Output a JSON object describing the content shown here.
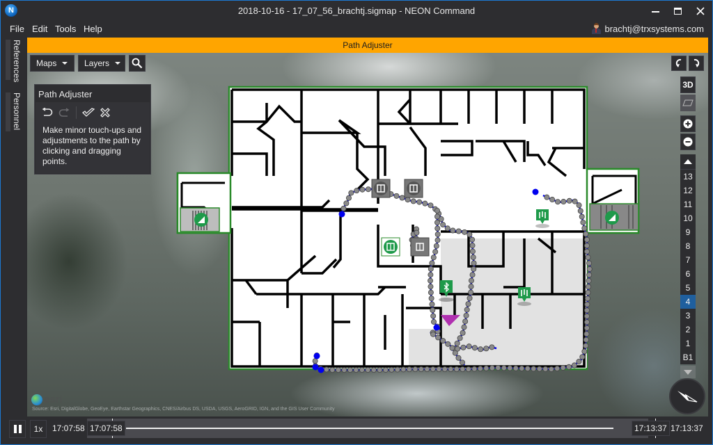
{
  "window": {
    "title": "2018-10-16 - 17_07_56_brachtj.sigmap - NEON Command",
    "app_logo": "N",
    "controls": [
      "minimize",
      "maximize",
      "close"
    ]
  },
  "menu": {
    "items": [
      "File",
      "Edit",
      "Tools",
      "Help"
    ],
    "user": "brachtj@trxsystems.com"
  },
  "sidebar": {
    "tabs": [
      {
        "label": "References"
      },
      {
        "label": "Personnel"
      }
    ]
  },
  "mode_banner": "Path Adjuster",
  "map_toolbar": {
    "maps_label": "Maps",
    "layers_label": "Layers",
    "search_icon": "search-icon"
  },
  "path_adjuster": {
    "title": "Path Adjuster",
    "tools": [
      "undo",
      "redo",
      "accept",
      "cancel"
    ],
    "description": "Make minor touch-ups and adjustments to the path by clicking and dragging points."
  },
  "view_controls": {
    "rotate_left": "rotate-left",
    "rotate_right": "rotate-right",
    "mode_3d": "3D",
    "mode_2d": "2D",
    "zoom_in": "+",
    "zoom_out": "-"
  },
  "floors": {
    "items": [
      "13",
      "12",
      "11",
      "10",
      "9",
      "8",
      "7",
      "6",
      "5",
      "4",
      "3",
      "2",
      "1",
      "B1"
    ],
    "selected": "4"
  },
  "map_markers": {
    "stairs": 2,
    "elevators": 4,
    "restrooms": 2,
    "bluetooth_beacons": 1
  },
  "attribution": {
    "logo_text": "esri",
    "source": "Source: Esri, DigitalGlobe, GeoEye, Earthstar Geographics, CNES/Airbus DS, USDA, USGS, AeroGRID, IGN, and the GIS User Community"
  },
  "timeline": {
    "state": "playing",
    "speed": "1x",
    "start_time": "17:07:58",
    "handle_start": "17:07:58",
    "handle_end": "17:13:37",
    "end_time": "17:13:37"
  },
  "colors": {
    "accent": "#ffa500",
    "selection": "#1f5f9e",
    "window_border": "#1c7ad4",
    "building_outline": "#2a8a2a",
    "path_line": "#0000ee",
    "path_point": "#888888",
    "marker_green": "#1e9a4a",
    "position_marker": "#b030b0"
  }
}
